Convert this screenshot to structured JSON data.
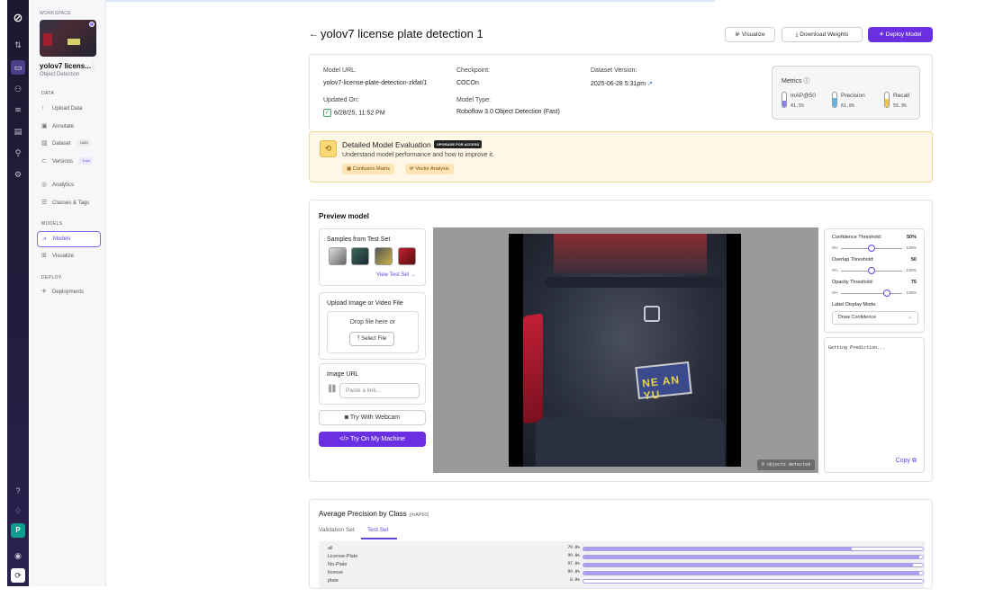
{
  "workspace": {
    "label": "WORKSPACE",
    "project_title": "yolov7 licens...",
    "project_type": "Object Detection"
  },
  "sidebar": {
    "sections": {
      "data": "DATA",
      "models": "MODELS",
      "deploy": "DEPLOY"
    },
    "items": [
      {
        "label": "Upload Data",
        "icon": "upload-icon"
      },
      {
        "label": "Annotate",
        "icon": "annotate-icon"
      },
      {
        "label": "Dataset",
        "icon": "dataset-icon",
        "tag": "1429"
      },
      {
        "label": "Versions",
        "icon": "versions-icon",
        "tag": "Train"
      },
      {
        "label": "Analytics",
        "icon": "analytics-icon"
      },
      {
        "label": "Classes & Tags",
        "icon": "classes-icon"
      },
      {
        "label": "Models",
        "icon": "models-icon",
        "active": true
      },
      {
        "label": "Visualize",
        "icon": "visualize-icon"
      },
      {
        "label": "Deployments",
        "icon": "deployments-icon"
      }
    ]
  },
  "rail": {
    "avatar_letter": "P"
  },
  "header": {
    "back": "←",
    "title": "yolov7 license plate detection 1",
    "buttons": {
      "visualize": "Visualize",
      "download": "Download Weights",
      "deploy": "Deploy Model"
    }
  },
  "info": {
    "model_url_label": "Model URL:",
    "model_url": "yolov7-license-plate-detection-zkfat/1",
    "checkpoint_label": "Checkpoint:",
    "checkpoint": "COCOn",
    "dataset_version_label": "Dataset Version:",
    "dataset_version": "2025-06-28 5:31pm",
    "dataset_version_link_icon": "↗",
    "updated_label": "Updated On:",
    "updated": "6/28/25, 11:52 PM",
    "model_type_label": "Model Type:",
    "model_type": "Roboflow 3.0 Object Detection (Fast)"
  },
  "metrics": {
    "title": "Metrics",
    "items": [
      {
        "name": "mAP@50",
        "value": "41.5%",
        "fraction": 0.415,
        "color": "#8b7ff0"
      },
      {
        "name": "Precision",
        "value": "61.0%",
        "fraction": 0.61,
        "color": "#5fb4e8"
      },
      {
        "name": "Recall",
        "value": "55.9%",
        "fraction": 0.559,
        "color": "#f2c94c"
      }
    ]
  },
  "evaluation": {
    "title": "Detailed Model Evaluation",
    "badge": "UPGRADE FOR ACCESS",
    "subtitle": "Understand model performance and how to improve it.",
    "chips": [
      "Confusion Matrix",
      "Vector Analysis"
    ]
  },
  "preview": {
    "title": "Preview model",
    "samples_title": "Samples from Test Set",
    "view_test_set": "View Test Set →",
    "upload_title": "Upload Image or Video File",
    "drop_text": "Drop file here or",
    "select_file": "Select File",
    "image_url_title": "Image URL",
    "url_placeholder": "Paste a link...",
    "webcam": "Try With Webcam",
    "machine": "Try On My Machine",
    "objects_detected": "0 objects detected",
    "plate_text": "NE AN YU",
    "controls": {
      "confidence_label": "Confidence Threshold:",
      "confidence_value": "50%",
      "confidence_fraction": 0.5,
      "overlap_label": "Overlap Threshold:",
      "overlap_value": "50",
      "overlap_fraction": 0.5,
      "opacity_label": "Opacity Threshold:",
      "opacity_value": "75",
      "opacity_fraction": 0.75,
      "min": "0%",
      "max": "100%",
      "label_mode_label": "Label Display Mode:",
      "label_mode": "Draw Confidence"
    },
    "log_text": "Getting Prediction...",
    "copy": "Copy"
  },
  "ap": {
    "title": "Average Precision by Class",
    "subtitle": "(mAP50)",
    "tabs": [
      "Validation Set",
      "Test Set"
    ],
    "rows": [
      {
        "name": "all",
        "pct": "79.0%",
        "value": 0.79
      },
      {
        "name": "License-Plate",
        "pct": "99.0%",
        "value": 0.99
      },
      {
        "name": "No-Plate",
        "pct": "97.0%",
        "value": 0.97
      },
      {
        "name": "license",
        "pct": "99.0%",
        "value": 0.99
      },
      {
        "name": "plate",
        "pct": "0.0%",
        "value": 0.0
      }
    ]
  }
}
